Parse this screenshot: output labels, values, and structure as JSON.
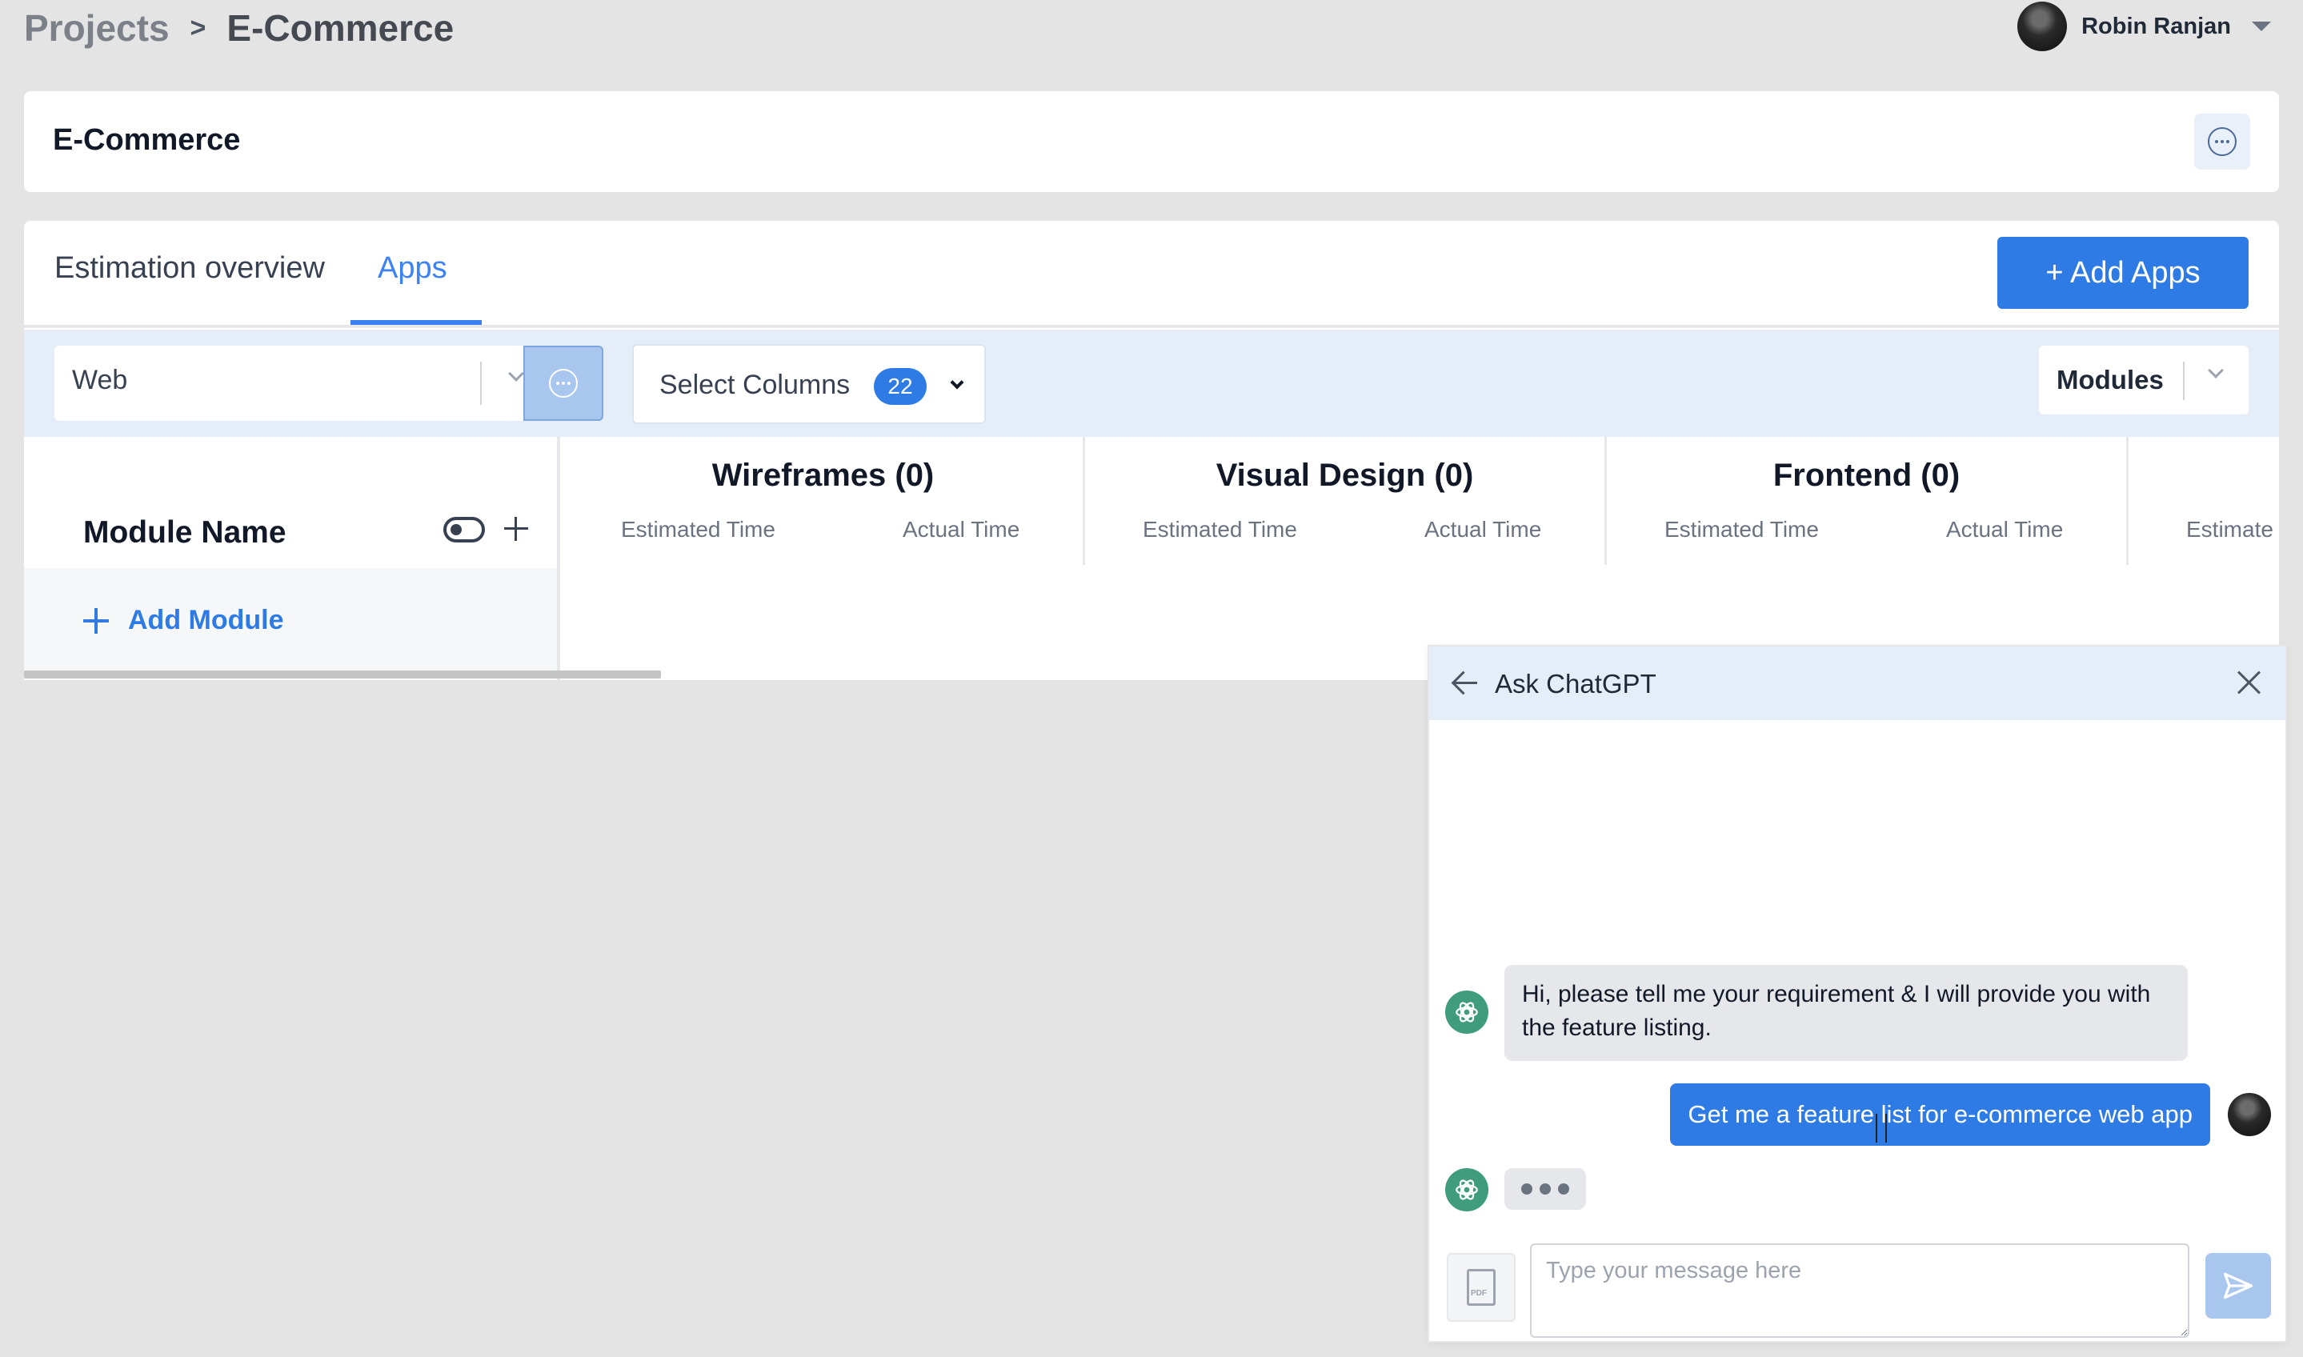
{
  "breadcrumb": {
    "parent": "Projects",
    "separator": ">",
    "current": "E-Commerce"
  },
  "user": {
    "name": "Robin Ranjan"
  },
  "project": {
    "title": "E-Commerce"
  },
  "tabs": [
    {
      "label": "Estimation overview",
      "active": false
    },
    {
      "label": "Apps",
      "active": true
    }
  ],
  "toolbar": {
    "add_apps_label": "+ Add Apps",
    "platform_value": "Web",
    "columns_label": "Select Columns",
    "columns_count": "22",
    "modules_label": "Modules"
  },
  "table": {
    "module_header": "Module Name",
    "add_module_label": "Add Module",
    "groups": [
      {
        "title": "Wireframes (0)",
        "estimated": "Estimated Time",
        "actual": "Actual Time"
      },
      {
        "title": "Visual Design (0)",
        "estimated": "Estimated Time",
        "actual": "Actual Time"
      },
      {
        "title": "Frontend (0)",
        "estimated": "Estimated Time",
        "actual": "Actual Time"
      },
      {
        "title": "",
        "estimated": "Estimate",
        "actual": ""
      }
    ]
  },
  "chat": {
    "title": "Ask ChatGPT",
    "bot_message": "Hi, please tell me your requirement & I will provide you with the feature listing.",
    "user_message": "Get me a feature list for e-commerce web app",
    "input_placeholder": "Type your message here",
    "attach_icon_text": "PDF"
  },
  "colors": {
    "accent": "#2f7be5",
    "background": "#e4e4e4",
    "filterbar": "#e5edf8",
    "gpt_green": "#3f9c7c"
  },
  "icons": [
    "chevron-right-icon",
    "caret-down-icon",
    "more-options-icon",
    "toggle-icon",
    "plus-icon",
    "back-arrow-icon",
    "close-icon",
    "chatgpt-logo-icon",
    "pdf-file-icon",
    "send-icon"
  ]
}
